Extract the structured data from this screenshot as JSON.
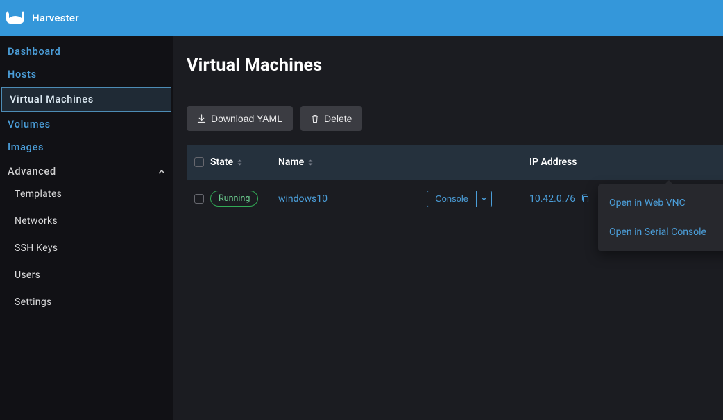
{
  "header": {
    "product_name": "Harvester"
  },
  "sidebar": {
    "items": [
      {
        "label": "Dashboard"
      },
      {
        "label": "Hosts"
      },
      {
        "label": "Virtual Machines",
        "active": true
      },
      {
        "label": "Volumes"
      },
      {
        "label": "Images"
      }
    ],
    "advanced": {
      "label": "Advanced",
      "expanded": true,
      "items": [
        {
          "label": "Templates"
        },
        {
          "label": "Networks"
        },
        {
          "label": "SSH Keys"
        },
        {
          "label": "Users"
        },
        {
          "label": "Settings"
        }
      ]
    }
  },
  "page": {
    "title": "Virtual Machines"
  },
  "toolbar": {
    "download_label": "Download YAML",
    "delete_label": "Delete"
  },
  "table": {
    "columns": {
      "state": "State",
      "name": "Name",
      "ip": "IP Address"
    },
    "rows": [
      {
        "state": "Running",
        "name": "windows10",
        "console_label": "Console",
        "ip": "10.42.0.76"
      }
    ]
  },
  "dropdown": {
    "items": [
      {
        "label": "Open in Web VNC"
      },
      {
        "label": "Open in Serial Console"
      }
    ]
  }
}
